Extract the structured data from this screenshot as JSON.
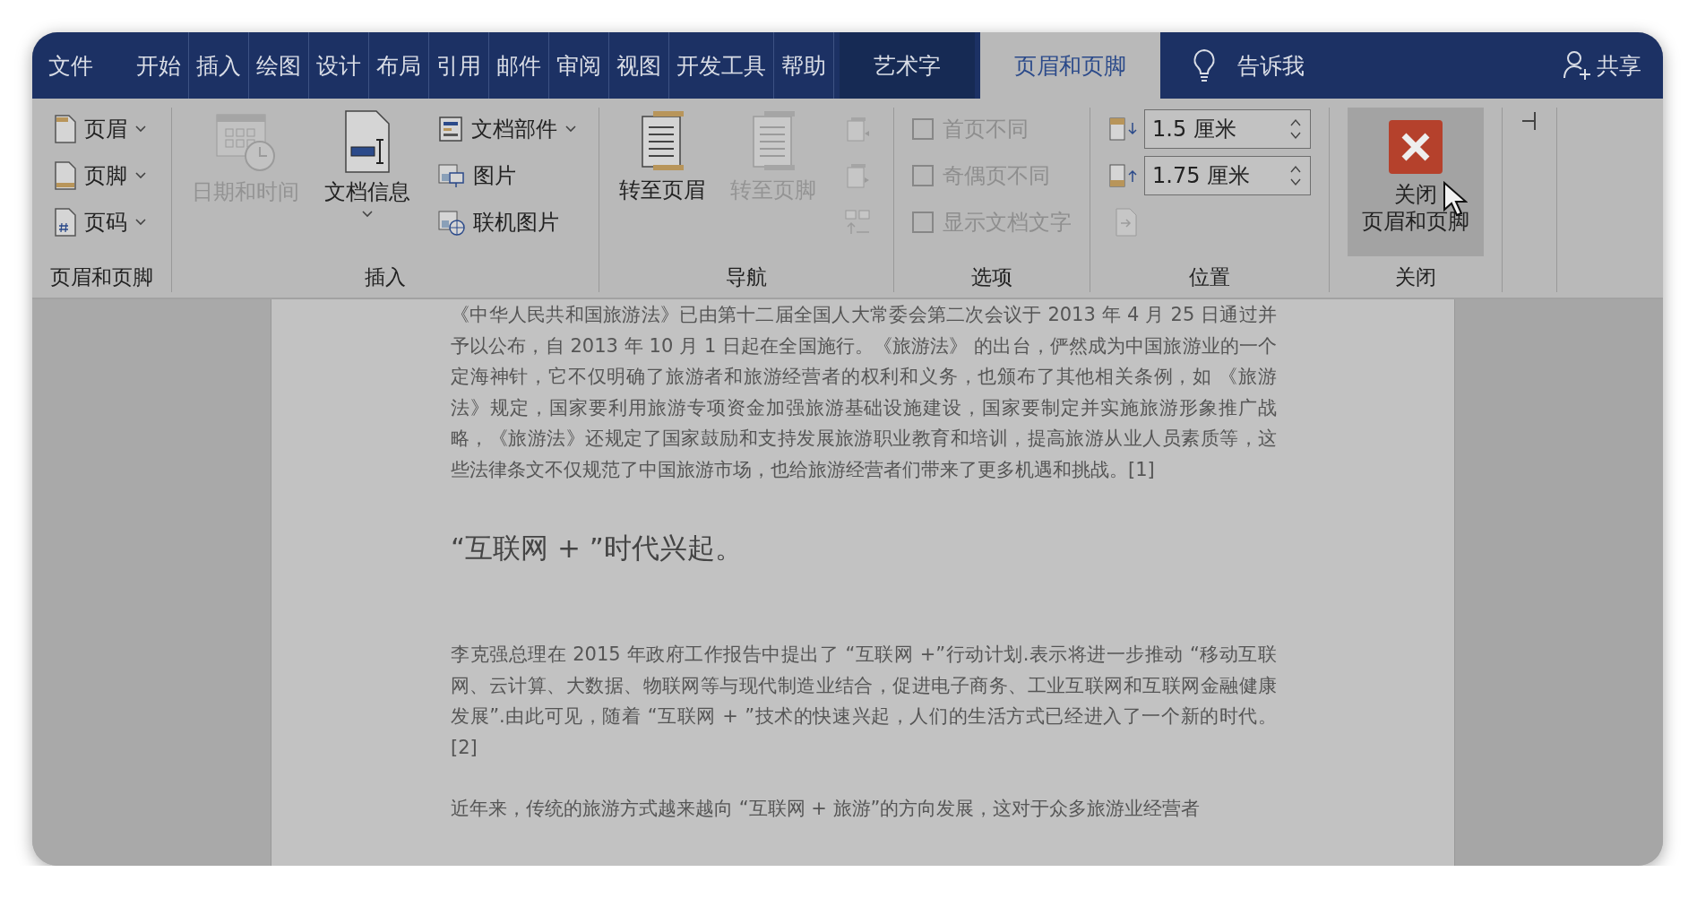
{
  "tabs": [
    {
      "label": "文件",
      "selected": false,
      "kind": "file"
    },
    {
      "label": "开始",
      "selected": false,
      "kind": "normal"
    },
    {
      "label": "插入",
      "selected": false,
      "kind": "normal"
    },
    {
      "label": "绘图",
      "selected": false,
      "kind": "normal"
    },
    {
      "label": "设计",
      "selected": false,
      "kind": "normal"
    },
    {
      "label": "布局",
      "selected": false,
      "kind": "normal"
    },
    {
      "label": "引用",
      "selected": false,
      "kind": "normal"
    },
    {
      "label": "邮件",
      "selected": false,
      "kind": "normal"
    },
    {
      "label": "审阅",
      "selected": false,
      "kind": "normal"
    },
    {
      "label": "视图",
      "selected": false,
      "kind": "normal"
    },
    {
      "label": "开发工具",
      "selected": false,
      "kind": "normal"
    },
    {
      "label": "帮助",
      "selected": false,
      "kind": "normal"
    },
    {
      "label": "艺术字",
      "selected": false,
      "kind": "contextual"
    },
    {
      "label": "页眉和页脚",
      "selected": true,
      "kind": "contextual"
    }
  ],
  "tell_me": "告诉我",
  "share": "共享",
  "ribbon": [
    {
      "label": "页眉和页脚",
      "items": [
        {
          "kind": "small",
          "label": "页眉",
          "dropdown": true,
          "disabled": false
        },
        {
          "kind": "small",
          "label": "页脚",
          "dropdown": true,
          "disabled": false
        },
        {
          "kind": "small",
          "label": "页码",
          "dropdown": true,
          "disabled": false
        }
      ]
    },
    {
      "label": "插入",
      "items": [
        {
          "kind": "large",
          "label": "日期和时间",
          "dropdown": false,
          "disabled": true
        },
        {
          "kind": "large",
          "label": "文档信息",
          "dropdown": true,
          "disabled": false
        },
        {
          "kind": "small",
          "label": "文档部件",
          "dropdown": true,
          "disabled": false
        },
        {
          "kind": "small",
          "label": "图片",
          "dropdown": false,
          "disabled": false
        },
        {
          "kind": "small",
          "label": "联机图片",
          "dropdown": false,
          "disabled": false
        }
      ]
    },
    {
      "label": "导航",
      "items": [
        {
          "kind": "large",
          "label": "转至页眉",
          "dropdown": false,
          "disabled": false
        },
        {
          "kind": "large",
          "label": "转至页脚",
          "dropdown": false,
          "disabled": true
        },
        {
          "kind": "icon",
          "disabled": true
        },
        {
          "kind": "icon",
          "disabled": true
        },
        {
          "kind": "icon",
          "disabled": true
        }
      ]
    },
    {
      "label": "选项",
      "items": [
        {
          "kind": "checkbox",
          "label": "首页不同",
          "checked": false,
          "disabled": true
        },
        {
          "kind": "checkbox",
          "label": "奇偶页不同",
          "checked": false,
          "disabled": true
        },
        {
          "kind": "checkbox",
          "label": "显示文档文字",
          "checked": false,
          "disabled": true
        }
      ]
    },
    {
      "label": "位置",
      "items": [
        {
          "kind": "spinner",
          "value": "1.5 厘米",
          "disabled": false
        },
        {
          "kind": "spinner",
          "value": "1.75 厘米",
          "disabled": false
        },
        {
          "kind": "icon",
          "disabled": true
        }
      ]
    },
    {
      "label": "关闭",
      "items": [
        {
          "kind": "close",
          "label_lines": [
            "关闭",
            "页眉和页脚"
          ],
          "hovered": true,
          "disabled": false
        }
      ]
    }
  ],
  "document": [
    {
      "kind": "paragraph",
      "text": "《中华人民共和国旅游法》已由第十二届全国人大常委会第二次会议于 2013 年 4 月 25 日通过并予以公布，自 2013 年 10 月 1 日起在全国施行。《旅游法》 的出台，俨然成为中国旅游业的一个定海神针，它不仅明确了旅游者和旅游经营者的权利和义务，也颁布了其他相关条例，如 《旅游法》规定，国家要利用旅游专项资金加强旅游基础设施建设，国家要制定并实施旅游形象推广战略，《旅游法》还规定了国家鼓励和支持发展旅游职业教育和培训，提高旅游从业人员素质等，这些法律条文不仅规范了中国旅游市场，也给旅游经营者们带来了更多机遇和挑战。[1]"
    },
    {
      "kind": "heading",
      "text": "“互联网 + ”时代兴起。"
    },
    {
      "kind": "paragraph",
      "text": "李克强总理在 2015 年政府工作报告中提出了 “互联网 +”行动计划.表示将进一步推动 “移动互联网、云计算、大数据、物联网等与现代制造业结合，促进电子商务、工业互联网和互联网金融健康发展”.由此可见，随着 “互联网 + ”技术的快速兴起，人们的生活方式已经进入了一个新的时代。[2]"
    },
    {
      "kind": "paragraph",
      "text": "近年来，传统的旅游方式越来越向 “互联网 + 旅游”的方向发展，这对于众多旅游业经营者"
    }
  ]
}
